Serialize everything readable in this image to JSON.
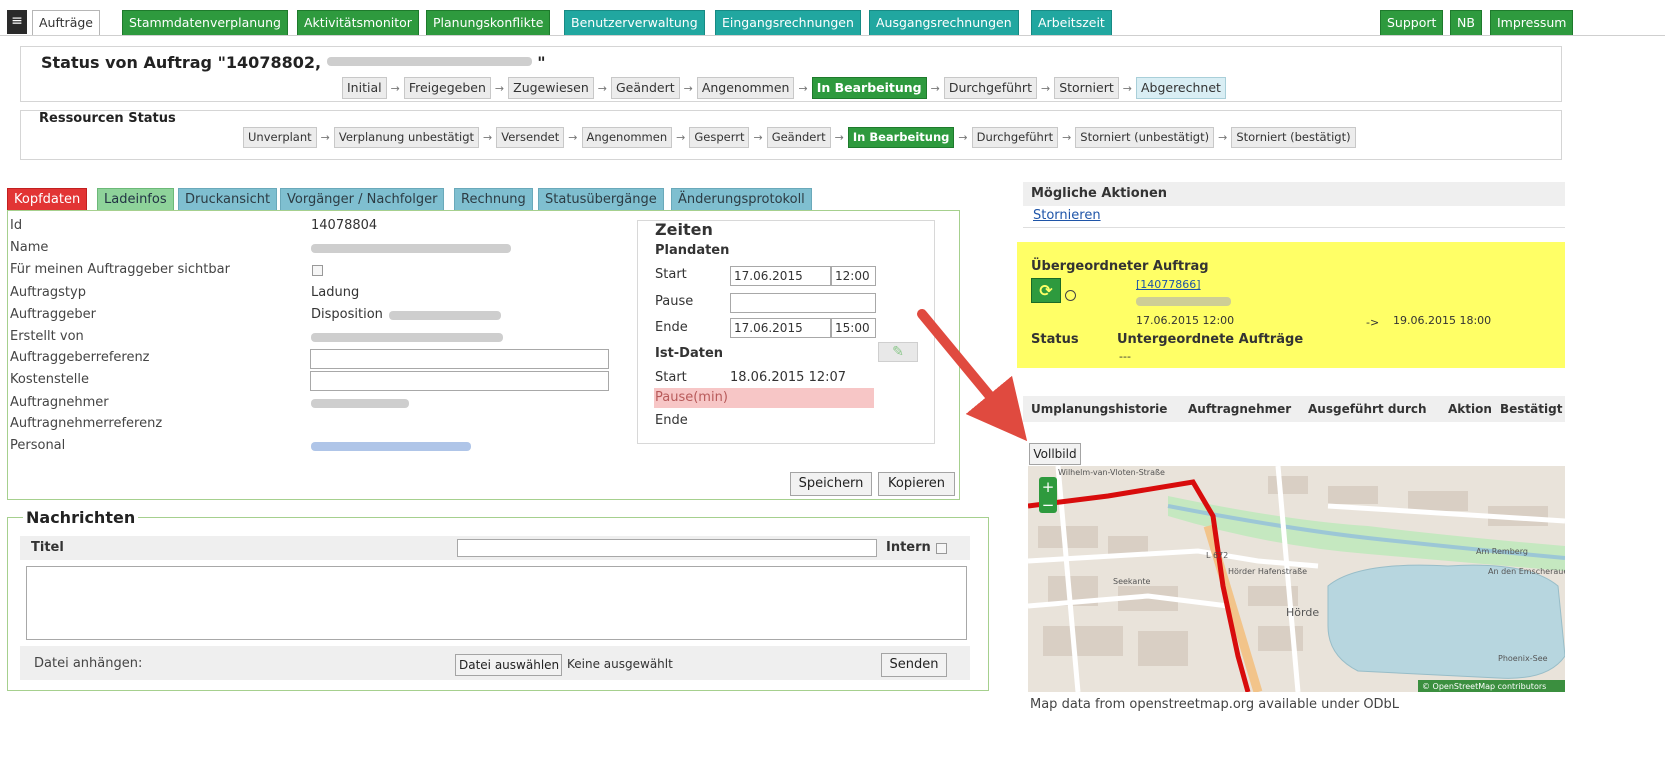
{
  "nav": {
    "menu_icon": "hamburger-icon",
    "tabs_left": [
      "Aufträge",
      "Stammdatenverplanung",
      "Aktivitätsmonitor",
      "Planungskonflikte",
      "Benutzerverwaltung",
      "Eingangsrechnungen",
      "Ausgangsrechnungen",
      "Arbeitszeit"
    ],
    "tabs_right": [
      "Support",
      "NB",
      "Impressum"
    ]
  },
  "order_status": {
    "title": "Status von Auftrag \"14078802,",
    "title_suffix": "\"",
    "steps": [
      "Initial",
      "Freigegeben",
      "Zugewiesen",
      "Geändert",
      "Angenommen",
      "In Bearbeitung",
      "Durchgeführt",
      "Storniert",
      "Abgerechnet"
    ],
    "active": "In Bearbeitung"
  },
  "resource_status": {
    "title": "Ressourcen Status",
    "steps": [
      "Unverplant",
      "Verplanung unbestätigt",
      "Versendet",
      "Angenommen",
      "Gesperrt",
      "Geändert",
      "In Bearbeitung",
      "Durchgeführt",
      "Storniert (unbestätigt)",
      "Storniert (bestätigt)"
    ],
    "active": "In Bearbeitung"
  },
  "tabs": [
    "Kopfdaten",
    "Ladeinfos",
    "Druckansicht",
    "Vorgänger / Nachfolger",
    "Rechnung",
    "Statusübergänge",
    "Änderungsprotokoll"
  ],
  "kopfdaten": {
    "fields": [
      {
        "label": "Id",
        "value": "14078804"
      },
      {
        "label": "Name",
        "value": ""
      },
      {
        "label": "Für meinen Auftraggeber sichtbar",
        "value": ""
      },
      {
        "label": "Auftragstyp",
        "value": "Ladung"
      },
      {
        "label": "Auftraggeber",
        "value": "Disposition"
      },
      {
        "label": "Erstellt von",
        "value": ""
      },
      {
        "label": "Auftraggeberreferenz",
        "value": ""
      },
      {
        "label": "Kostenstelle",
        "value": ""
      },
      {
        "label": "Auftragnehmer",
        "value": ""
      },
      {
        "label": "Auftragnehmerreferenz",
        "value": ""
      },
      {
        "label": "Personal",
        "value": ""
      }
    ],
    "save_label": "Speichern",
    "copy_label": "Kopieren"
  },
  "zeiten": {
    "title": "Zeiten",
    "plan_title": "Plandaten",
    "start_label": "Start",
    "start_date": "17.06.2015",
    "start_time": "12:00",
    "pause_label": "Pause",
    "end_label": "Ende",
    "end_date": "17.06.2015",
    "end_time": "15:00",
    "ist_title": "Ist-Daten",
    "ist_start_label": "Start",
    "ist_start_value": "18.06.2015 12:07",
    "ist_pause_label": "Pause(min)",
    "ist_end_label": "Ende",
    "edit_icon": "pencil-icon"
  },
  "nachrichten": {
    "title": "Nachrichten",
    "titel_label": "Titel",
    "intern_label": "Intern",
    "attach_label": "Datei anhängen:",
    "choose_file_label": "Datei auswählen",
    "no_file_label": "Keine ausgewählt",
    "send_label": "Senden"
  },
  "aktionen": {
    "title": "Mögliche Aktionen",
    "link": "Stornieren"
  },
  "uebergeordnet": {
    "title": "Übergeordneter Auftrag",
    "order_link": "[14077866]",
    "start": "17.06.2015 12:00",
    "arrow": "->",
    "end": "19.06.2015 18:00",
    "status_label": "Status",
    "sub_label": "Untergeordnete Aufträge",
    "sub_value": "---",
    "refresh_icon": "refresh-icon",
    "highlight_color": "#ffff66"
  },
  "history": {
    "columns": [
      "Umplanungshistorie",
      "Auftragnehmer",
      "Ausgeführt durch",
      "Aktion",
      "Bestätigt"
    ]
  },
  "map": {
    "fullscreen_label": "Vollbild",
    "zoom_in": "+",
    "zoom_out": "−",
    "attribution": "© OpenStreetMap contributors",
    "caption": "Map data from openstreetmap.org available under ODbL",
    "labels": [
      "Wilhelm-van-Vloten-Straße",
      "Hörder Hafenstraße",
      "Am Remberg",
      "Hörde",
      "Phoenix-See",
      "L 672",
      "Seekante",
      "An den Emscherauen"
    ]
  },
  "colors": {
    "nav_green": "#2e9a3e",
    "nav_teal": "#21a7a0",
    "tab_red": "#e23434",
    "tab_blue": "#7fbfd0",
    "annotation_arrow": "#e04a3f",
    "pause_highlight": "#f7c6c6"
  }
}
